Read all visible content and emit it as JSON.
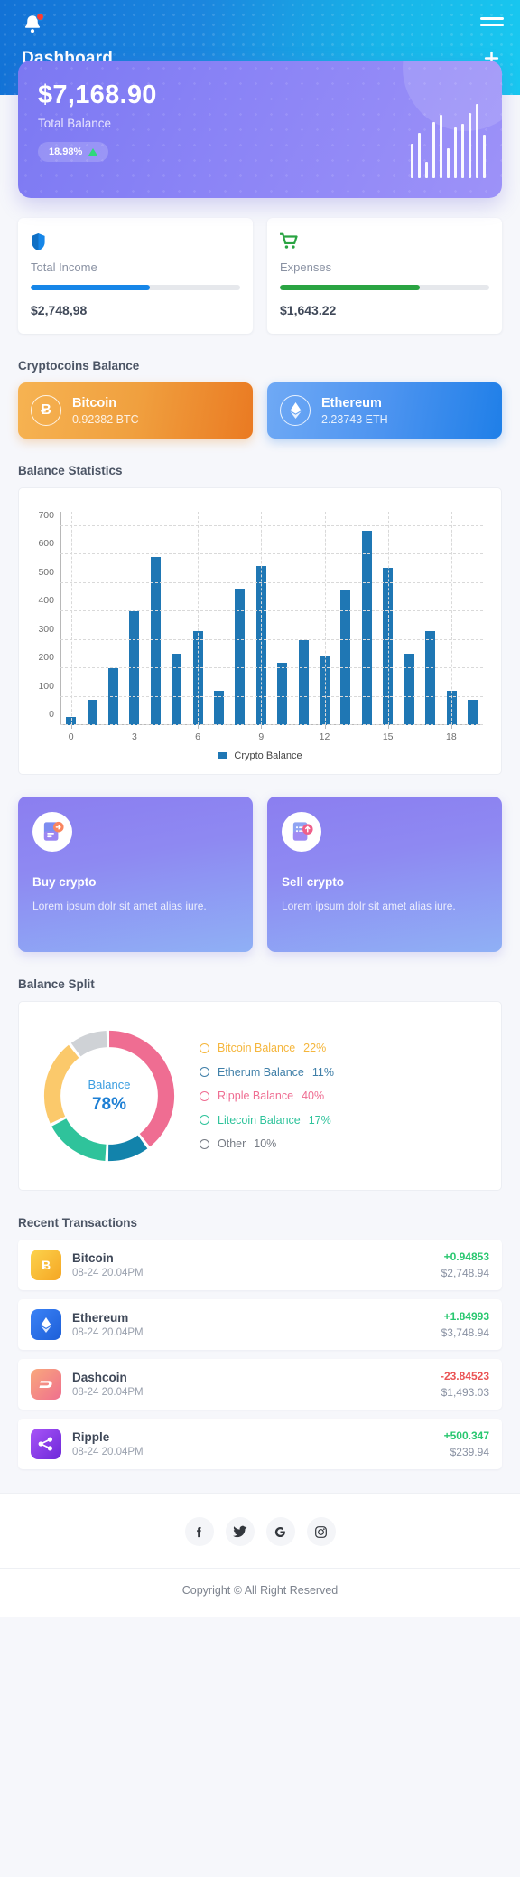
{
  "header": {
    "title": "Dashboard",
    "bell_icon": "bell-icon",
    "menu_icon": "hamburger-menu-icon",
    "add_icon": "plus-icon"
  },
  "hero": {
    "amount": "$7,168.90",
    "label": "Total Balance",
    "change": "18.98%",
    "trend": "up",
    "sparkline": [
      38,
      50,
      18,
      62,
      70,
      33,
      56,
      60,
      72,
      82,
      48
    ]
  },
  "stats": [
    {
      "icon": "shield-icon",
      "name": "Total Income",
      "value": "$2,748,98",
      "progress": 57,
      "color": "#1686e8"
    },
    {
      "icon": "shopping-cart-icon",
      "name": "Expenses",
      "value": "$1,643.22",
      "progress": 67,
      "color": "#2aa442"
    }
  ],
  "cryptocoins": {
    "section_title": "Cryptocoins Balance",
    "items": [
      {
        "symbol": "Ƀ",
        "name": "Bitcoin",
        "amount": "0.92382 BTC",
        "icon": "bitcoin-icon"
      },
      {
        "symbol": "♦",
        "name": "Ethereum",
        "amount": "2.23743 ETH",
        "icon": "ethereum-icon"
      }
    ]
  },
  "balance_statistics": {
    "section_title": "Balance Statistics"
  },
  "chart_data": {
    "type": "bar",
    "title": "Balance Statistics",
    "xlabel": "",
    "ylabel": "",
    "ylim": [
      0,
      750
    ],
    "yticks": [
      0,
      100,
      200,
      300,
      400,
      500,
      600,
      700
    ],
    "xticks": [
      0,
      3,
      6,
      9,
      12,
      15,
      18
    ],
    "grid": true,
    "legend_position": "bottom",
    "categories": [
      0,
      1,
      2,
      3,
      4,
      5,
      6,
      7,
      8,
      9,
      10,
      11,
      12,
      13,
      14,
      15,
      16,
      17,
      18,
      19
    ],
    "series": [
      {
        "name": "Crypto Balance",
        "color": "#1f77b4",
        "values": [
          30,
          90,
          200,
          400,
          592,
          250,
          330,
          120,
          480,
          560,
          220,
          300,
          240,
          472,
          682,
          552,
          250,
          330,
          120,
          90
        ]
      }
    ]
  },
  "promos": [
    {
      "icon": "document-buy-icon",
      "title": "Buy crypto",
      "desc": "Lorem ipsum dolr sit amet alias iure."
    },
    {
      "icon": "document-sell-icon",
      "title": "Sell crypto",
      "desc": "Lorem ipsum dolr sit amet alias iure."
    }
  ],
  "balance_split": {
    "section_title": "Balance Split",
    "center_label": "Balance",
    "center_value": "78%",
    "legend": [
      {
        "label": "Bitcoin Balance",
        "percent": "22%",
        "color": "#f5b63c"
      },
      {
        "label": "Etherum Balance",
        "percent": "11%",
        "color": "#3f7fa8"
      },
      {
        "label": "Ripple Balance",
        "percent": "40%",
        "color": "#ef6d92"
      },
      {
        "label": "Litecoin Balance",
        "percent": "17%",
        "color": "#2fc39b"
      },
      {
        "label": "Other",
        "percent": "10%",
        "color": "#767b84"
      }
    ],
    "donut_chart": {
      "type": "pie",
      "labels": [
        "Ripple Balance",
        "Etherum Balance",
        "Litecoin Balance",
        "Bitcoin Balance",
        "Other"
      ],
      "values": [
        40,
        11,
        17,
        22,
        10
      ],
      "colors": [
        "#ef6d92",
        "#1283ab",
        "#2fc39b",
        "#fbc96b",
        "#cfd2d6"
      ]
    }
  },
  "recent_transactions": {
    "section_title": "Recent Transactions",
    "rows": [
      {
        "icon": "bitcoin-icon",
        "symbol": "Ƀ",
        "name": "Bitcoin",
        "date": "08-24  20.04PM",
        "delta": "+0.94853",
        "delta_sign": "positive",
        "amount": "$2,748.94",
        "icon_color": "linear-gradient(135deg,#fcd34d,#f5a623)"
      },
      {
        "icon": "ethereum-icon",
        "symbol": "♦",
        "name": "Ethereum",
        "date": "08-24  20.04PM",
        "delta": "+1.84993",
        "delta_sign": "positive",
        "amount": "$3,748.94",
        "icon_color": "linear-gradient(135deg,#3b82f6,#1d5fd8)"
      },
      {
        "icon": "dashcoin-icon",
        "symbol": "≡",
        "name": "Dashcoin",
        "date": "08-24  20.04PM",
        "delta": "-23.84523",
        "delta_sign": "negative",
        "amount": "$1,493.03",
        "icon_color": "linear-gradient(135deg,#f9a87c,#ef6f8e)"
      },
      {
        "icon": "ripple-icon",
        "symbol": "•",
        "name": "Ripple",
        "date": "08-24  20.04PM",
        "delta": "+500.347",
        "delta_sign": "positive",
        "amount": "$239.94",
        "icon_color": "linear-gradient(135deg,#a855f7,#6d28d9)"
      }
    ],
    "positive_color": "#28c76f",
    "negative_color": "#ea5455"
  },
  "footer": {
    "socials": [
      {
        "icon": "facebook-icon",
        "glyph": "f"
      },
      {
        "icon": "twitter-icon",
        "glyph": "t"
      },
      {
        "icon": "google-icon",
        "glyph": "G"
      },
      {
        "icon": "instagram-icon",
        "glyph": "i"
      }
    ],
    "copyright": "Copyright © All Right Reserved"
  }
}
